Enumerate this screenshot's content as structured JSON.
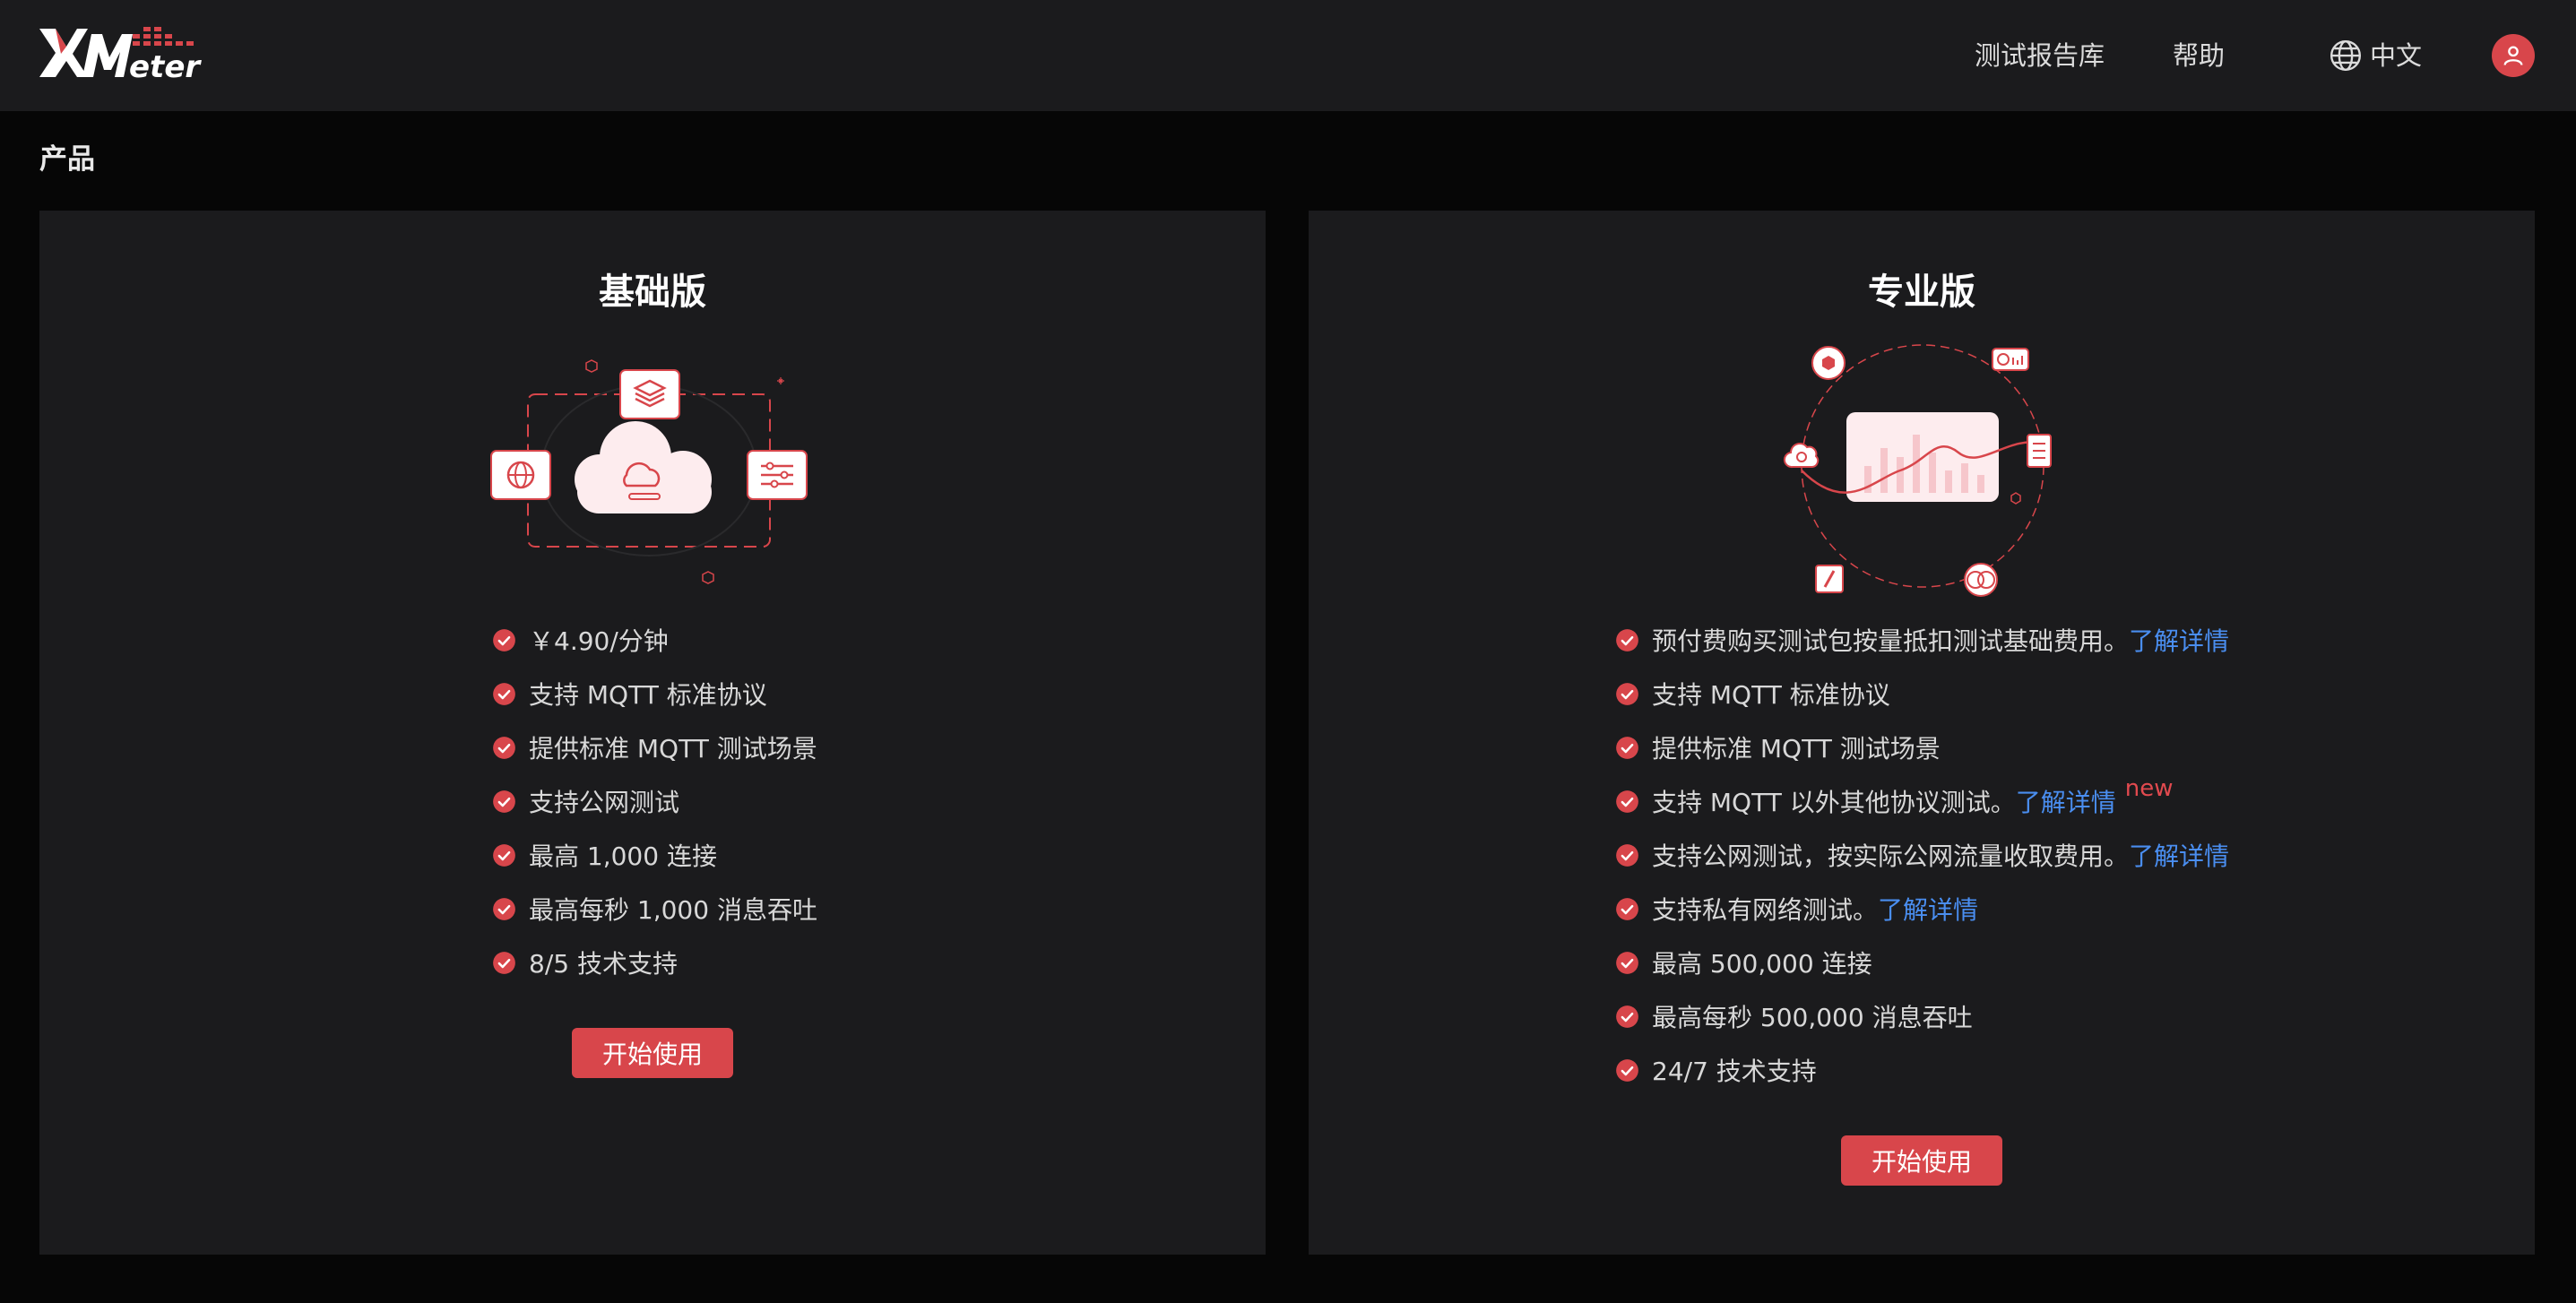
{
  "header": {
    "logo_text": "XMeter",
    "nav": {
      "reports": "测试报告库",
      "help": "帮助",
      "language": "中文"
    }
  },
  "page": {
    "title": "产品"
  },
  "plans": {
    "basic": {
      "title": "基础版",
      "features": [
        "￥4.90/分钟",
        "支持 MQTT 标准协议",
        "提供标准 MQTT 测试场景",
        "支持公网测试",
        "最高 1,000 连接",
        "最高每秒 1,000 消息吞吐",
        "8/5 技术支持"
      ],
      "start_label": "开始使用"
    },
    "pro": {
      "title": "专业版",
      "features": [
        {
          "text": "预付费购买测试包按量抵扣测试基础费用。",
          "link": "了解详情"
        },
        {
          "text": "支持 MQTT 标准协议"
        },
        {
          "text": "提供标准 MQTT 测试场景"
        },
        {
          "text": "支持 MQTT 以外其他协议测试。",
          "link": "了解详情",
          "tag": "new"
        },
        {
          "text": "支持公网测试，按实际公网流量收取费用。",
          "link": "了解详情"
        },
        {
          "text": "支持私有网络测试。",
          "link": "了解详情"
        },
        {
          "text": "最高 500,000 连接"
        },
        {
          "text": "最高每秒 500,000 消息吞吐"
        },
        {
          "text": "24/7 技术支持"
        }
      ],
      "start_label": "开始使用"
    }
  },
  "colors": {
    "accent": "#d8464b",
    "link": "#4a8ef0",
    "card_bg": "#1b1b1d",
    "page_bg": "#060606"
  },
  "icons": {
    "check": "check-circle-icon",
    "globe": "globe-icon",
    "user": "user-icon"
  }
}
